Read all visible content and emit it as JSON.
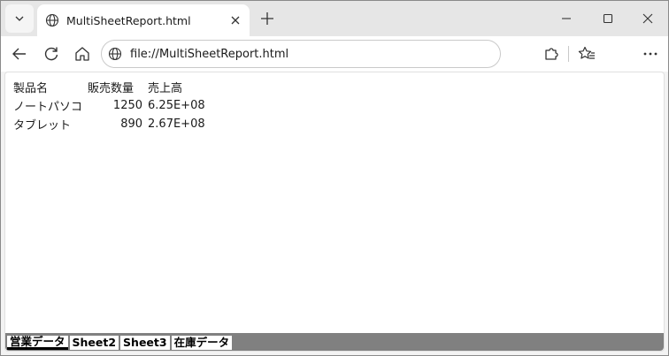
{
  "browser": {
    "tab": {
      "title": "MultiSheetReport.html"
    },
    "address": {
      "url": "file://MultiSheetReport.html"
    },
    "icons": {
      "tab_menu": "chevron-down-icon",
      "favicon": "globe-icon",
      "tab_close": "close-icon",
      "new_tab": "plus-icon",
      "minimize": "minimize-icon",
      "maximize": "maximize-icon",
      "close_window": "close-icon",
      "back": "arrow-left-icon",
      "reload": "reload-icon",
      "home": "home-icon",
      "extensions": "puzzle-icon",
      "favorites": "favorites-icon",
      "more": "more-icon"
    }
  },
  "sheet": {
    "headers": [
      "製品名",
      "販売数量",
      "売上高"
    ],
    "rows": [
      [
        "ノートパソコ",
        "1250",
        "6.25E+08"
      ],
      [
        "タブレット",
        "890",
        "2.67E+08"
      ]
    ]
  },
  "sheet_tabs": [
    {
      "label": "営業データ",
      "active": true
    },
    {
      "label": "Sheet2",
      "active": false
    },
    {
      "label": "Sheet3",
      "active": false
    },
    {
      "label": "在庫データ",
      "active": false
    }
  ],
  "colors": {
    "tabstrip_bg": "#e6e6e6",
    "sheetbar_bg": "#808080",
    "text": "#1a1a1a"
  }
}
